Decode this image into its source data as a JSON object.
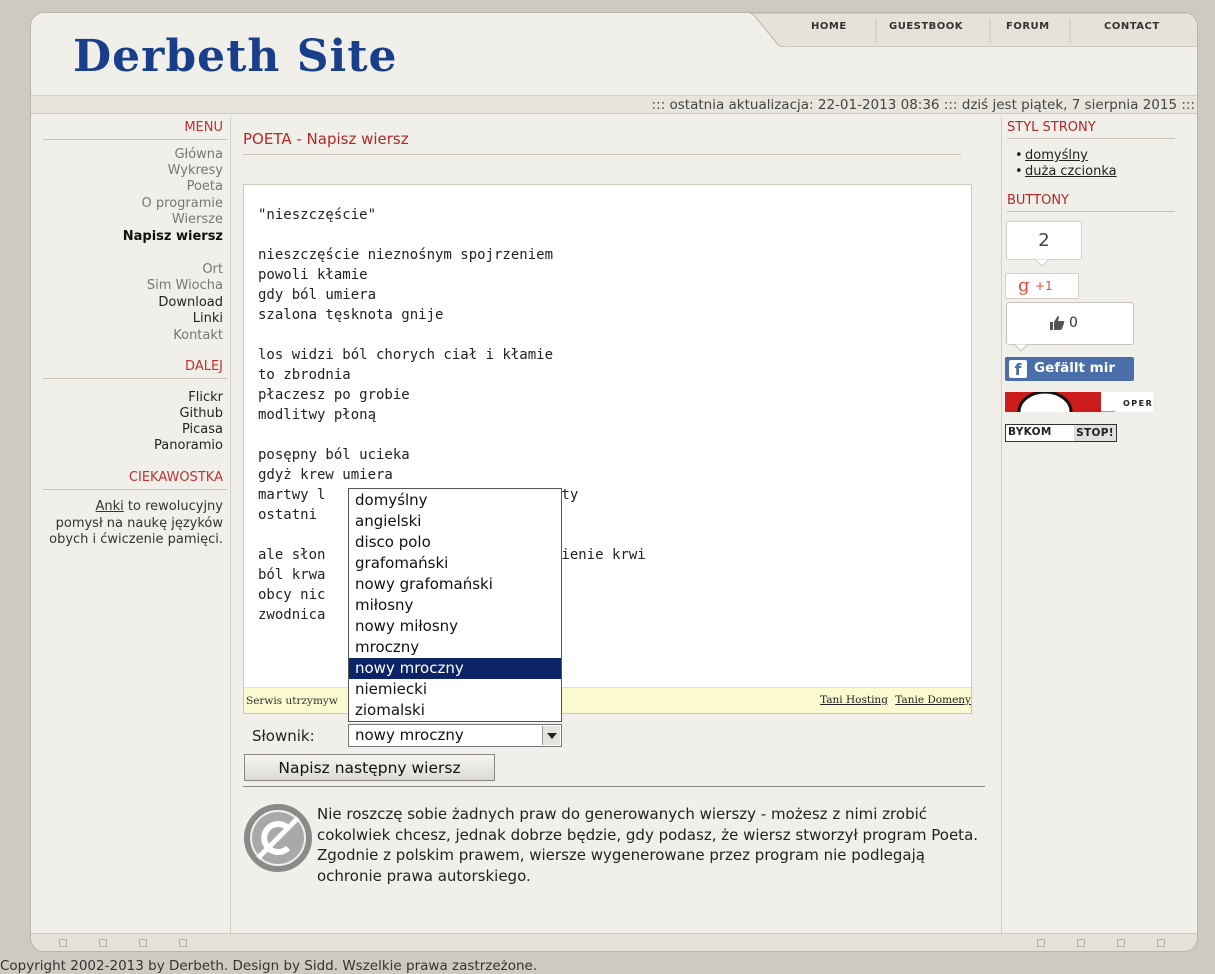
{
  "nav": {
    "items": [
      "HOME",
      "GUESTBOOK",
      "FORUM",
      "CONTACT"
    ]
  },
  "site": {
    "title": "Derbeth Site"
  },
  "update_bar": {
    "text": "::: ostatnia aktualizacja: 22-01-2013 08:36 ::: dziś jest piątek, 7 sierpnia 2015 :::"
  },
  "left": {
    "menu_title": "MENU",
    "menu_items": [
      "Główna",
      "Wykresy",
      "Poeta",
      "O programie",
      "Wiersze",
      "Napisz wiersz",
      "Ort",
      "Sim Wiocha",
      "Download",
      "Linki",
      "Kontakt"
    ],
    "dalej_title": "DALEJ",
    "dalej_items": [
      "Flickr",
      "Github",
      "Picasa",
      "Panoramio"
    ],
    "trivia_title": "CIEKAWOSTKA",
    "trivia_link": "Anki",
    "trivia_text": " to rewolucyjny pomysł na naukę języków obych i ćwiczenie pamięci."
  },
  "main": {
    "page_title": "POETA - Napisz wiersz",
    "poem": "\"nieszczęście\"\n\nnieszczęście nieznośnym spojrzeniem\npowoli kłamie\ngdy ból umiera\nszalona tęsknota gnije\n\nlos widzi ból chorych ciał i kłamie\nto zbrodnia\npłaczesz po grobie\nmodlitwy płoną\n\nposępny ból ucieka\ngdyż krew umiera\nmartwy l                    nie zemsty\nostatni                   em upadku\n\nale słon                ziecie cierpienie krwi\nból krwa\nobcy nic\nzwodnica                 y",
    "hosting_left": "Serwis utrzymyw",
    "hosting_links": [
      "Tani Hosting",
      "Tanie Domeny"
    ],
    "dict_label": "Słownik:",
    "dict_selected": "nowy mroczny",
    "dict_options": [
      "domyślny",
      "angielski",
      "disco polo",
      "grafomański",
      "nowy grafomański",
      "miłosny",
      "nowy miłosny",
      "mroczny",
      "nowy mroczny",
      "niemiecki",
      "ziomalski"
    ],
    "next_button": "Napisz następny wiersz",
    "license_text": "Nie roszczę sobie żadnych praw do generowanych wierszy - możesz z nimi zrobić cokolwiek chcesz, jednak dobrze będzie, gdy podasz, że wiersz stworzył program Poeta. Zgodnie z polskim prawem, wiersze wygenerowane przez program nie podlegają ochronie prawa autorskiego."
  },
  "right": {
    "style_title": "STYL STRONY",
    "style_links": [
      "domyślny",
      "duża czcionka"
    ],
    "buttons_title": "BUTTONY",
    "share_count": "2",
    "gplus": {
      "g": "g",
      "plus": "+1"
    },
    "like_count": "0",
    "fb_label": "Gefällt mir",
    "opera_label": "OPERA",
    "bykom": {
      "a": "BYKOM",
      "b": "STOP!"
    }
  },
  "footer": {
    "copyright": "Copyright 2002-2013 by Derbeth. Design by Sidd. Wszelkie prawa zastrzeżone."
  }
}
